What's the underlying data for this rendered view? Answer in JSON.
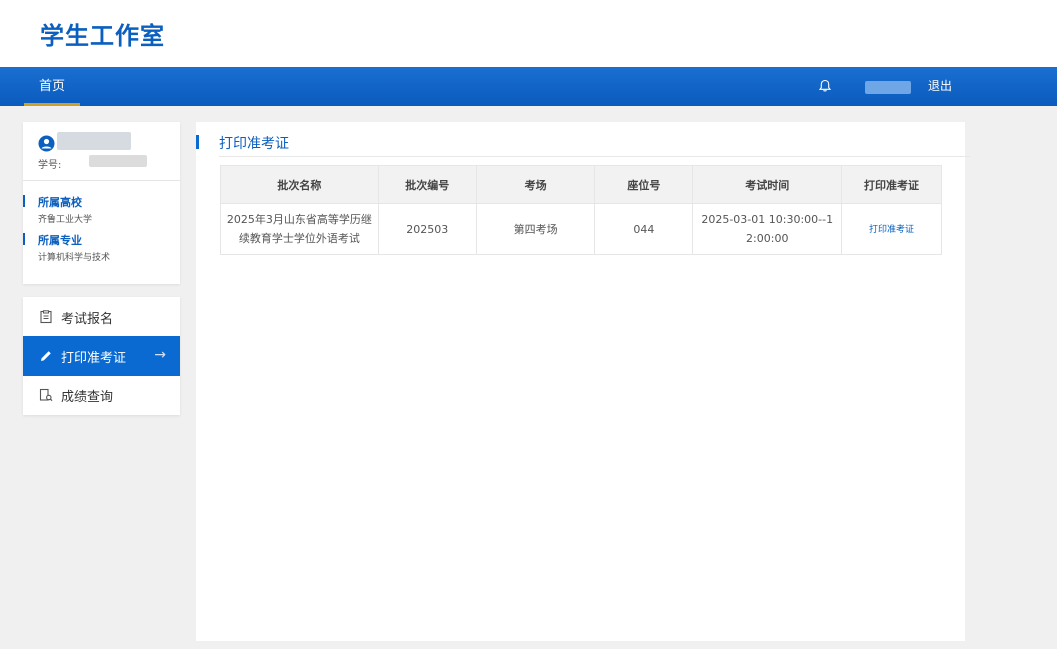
{
  "header": {
    "site_title": "学生工作室"
  },
  "nav": {
    "home": "首页",
    "logout": "退出"
  },
  "profile": {
    "id_label": "学号:",
    "school_label": "所属高校",
    "school_value": "齐鲁工业大学",
    "major_label": "所属专业",
    "major_value": "计算机科学与技术"
  },
  "menu": {
    "items": [
      {
        "label": "考试报名"
      },
      {
        "label": "打印准考证"
      },
      {
        "label": "成绩查询"
      }
    ]
  },
  "main": {
    "title": "打印准考证",
    "table": {
      "headers": [
        "批次名称",
        "批次编号",
        "考场",
        "座位号",
        "考试时间",
        "打印准考证"
      ],
      "rows": [
        {
          "batch_name": "2025年3月山东省高等学历继续教育学士学位外语考试",
          "batch_no": "202503",
          "room": "第四考场",
          "seat": "044",
          "time": "2025-03-01 10:30:00--12:00:00",
          "action": "打印准考证"
        }
      ]
    }
  },
  "colors": {
    "brand": "#0b5fbf",
    "nav_bg": "#0a5bbd",
    "active_menu": "#0b6ad1"
  },
  "icons": {
    "bell": "bell-icon",
    "avatar": "user-avatar-icon",
    "menu_register": "clipboard-icon",
    "menu_print": "pencil-icon",
    "menu_score": "search-document-icon",
    "arrow": "arrow-right-icon"
  }
}
